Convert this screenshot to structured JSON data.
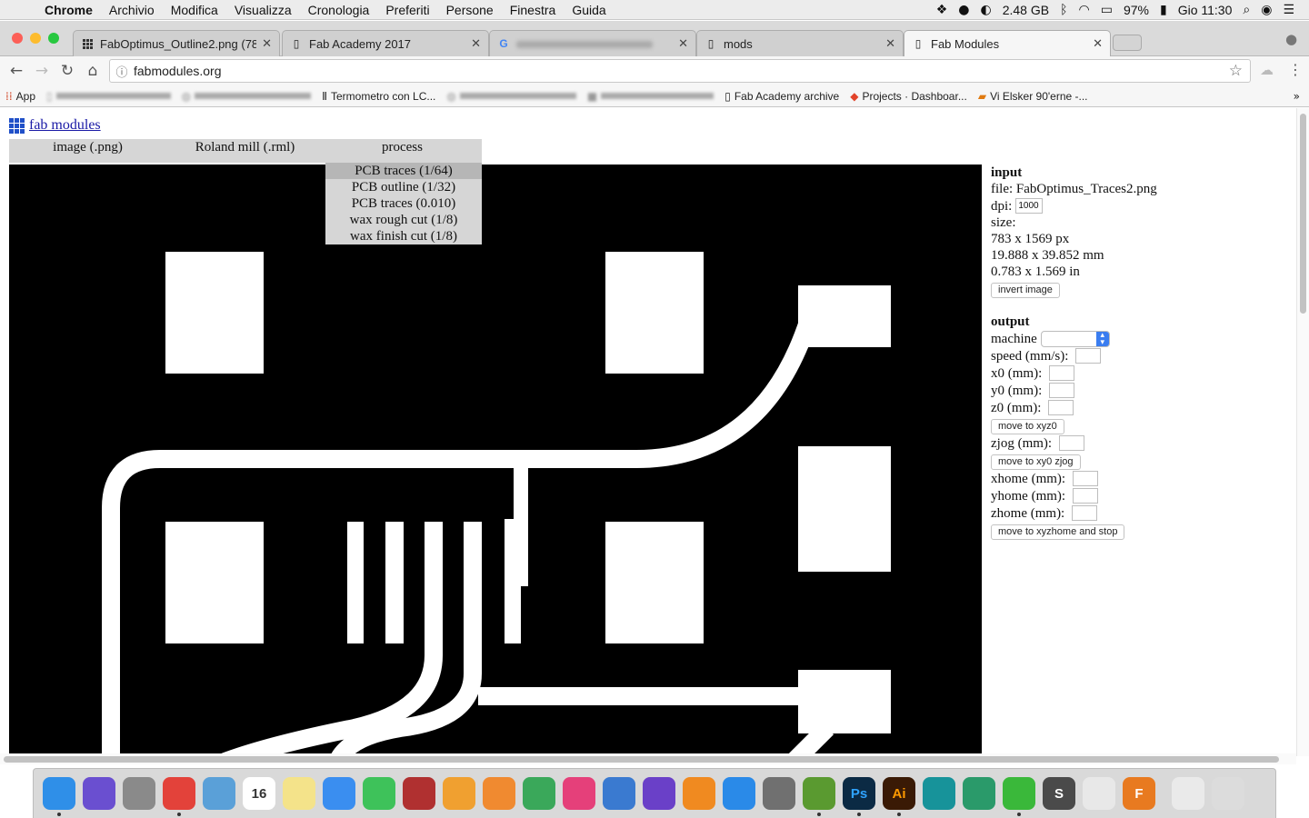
{
  "menubar": {
    "apple_icon": "apple-icon",
    "app_name": "Chrome",
    "items": [
      "Archivio",
      "Modifica",
      "Visualizza",
      "Cronologia",
      "Preferiti",
      "Persone",
      "Finestra",
      "Guida"
    ],
    "memory": "2.48 GB",
    "battery": "97%",
    "clock": "Gio 11:30"
  },
  "tabs": [
    {
      "title": "FabOptimus_Outline2.png (78",
      "icon": "grid-icon"
    },
    {
      "title": "Fab Academy 2017",
      "icon": "page-icon"
    },
    {
      "title": "",
      "icon": "google-icon"
    },
    {
      "title": "mods",
      "icon": "page-icon"
    },
    {
      "title": "Fab Modules",
      "icon": "page-icon"
    }
  ],
  "address": {
    "url": "fabmodules.org"
  },
  "bookmarks": [
    {
      "label": "App",
      "icon": "apps-grid-icon",
      "blurred": false
    },
    {
      "label": "",
      "icon": "page-icon",
      "blurred": true
    },
    {
      "label": "",
      "icon": "globe-icon",
      "blurred": true
    },
    {
      "label": "Termometro con LC...",
      "icon": "thermometer-icon",
      "blurred": false
    },
    {
      "label": "",
      "icon": "globe-icon",
      "blurred": true
    },
    {
      "label": "",
      "icon": "page-icon",
      "blurred": true
    },
    {
      "label": "Fab Academy archive",
      "icon": "page-icon",
      "blurred": false
    },
    {
      "label": "Projects · Dashboar...",
      "icon": "gitlab-icon",
      "blurred": false
    },
    {
      "label": "Vi Elsker 90'erne -...",
      "icon": "flag-icon",
      "blurred": false
    }
  ],
  "page": {
    "site_link": "fab modules",
    "menu": [
      "image (.png)",
      "Roland mill (.rml)",
      "process"
    ],
    "process_options": [
      "PCB traces (1/64)",
      "PCB outline (1/32)",
      "PCB traces (0.010)",
      "wax rough cut (1/8)",
      "wax finish cut (1/8)"
    ],
    "selected_process": "PCB traces (1/64)"
  },
  "panel": {
    "input_heading": "input",
    "file_line": "file: FabOptimus_Traces2.png",
    "dpi_label": "dpi:",
    "dpi_value": "1000",
    "size_label": "size:",
    "size_px": "783 x 1569 px",
    "size_mm": "19.888 x 39.852 mm",
    "size_in": "0.783 x 1.569 in",
    "invert_button": "invert image",
    "output_heading": "output",
    "machine_label": "machine",
    "speed_label": "speed (mm/s):",
    "x0_label": "x0 (mm):",
    "y0_label": "y0 (mm):",
    "z0_label": "z0 (mm):",
    "move_xyz0_button": "move to xyz0",
    "zjog_label": "zjog (mm):",
    "move_zjog_button": "move to xy0 zjog",
    "xhome_label": "xhome (mm):",
    "yhome_label": "yhome (mm):",
    "zhome_label": "zhome (mm):",
    "move_home_button": "move to xyzhome and stop"
  },
  "dock": [
    {
      "name": "finder-icon",
      "label": "",
      "color": "#2f8fe8"
    },
    {
      "name": "siri-icon",
      "label": "",
      "color": "#6a4fd0"
    },
    {
      "name": "launchpad-icon",
      "label": "",
      "color": "#8a8a8a"
    },
    {
      "name": "chrome-icon",
      "label": "",
      "color": "#e3423a"
    },
    {
      "name": "preview-icon",
      "label": "",
      "color": "#5aa0d8"
    },
    {
      "name": "calendar-icon",
      "label": "16",
      "color": "#ffffff"
    },
    {
      "name": "notes-icon",
      "label": "",
      "color": "#f4e38a"
    },
    {
      "name": "messages-icon",
      "label": "",
      "color": "#3a8ef0"
    },
    {
      "name": "facetime-icon",
      "label": "",
      "color": "#3ec25a"
    },
    {
      "name": "photobooth-icon",
      "label": "",
      "color": "#b03030"
    },
    {
      "name": "photos-icon",
      "label": "",
      "color": "#f0a030"
    },
    {
      "name": "pages-icon",
      "label": "",
      "color": "#f08a30"
    },
    {
      "name": "numbers-icon",
      "label": "",
      "color": "#3aa85a"
    },
    {
      "name": "itunes-icon",
      "label": "",
      "color": "#e5407a"
    },
    {
      "name": "keynote-icon",
      "label": "",
      "color": "#3a7ad0"
    },
    {
      "name": "imovie-icon",
      "label": "",
      "color": "#6a40c8"
    },
    {
      "name": "ibooks-icon",
      "label": "",
      "color": "#f08a20"
    },
    {
      "name": "appstore-icon",
      "label": "",
      "color": "#2a8ae8"
    },
    {
      "name": "system-preferences-icon",
      "label": "",
      "color": "#707070"
    },
    {
      "name": "qgis-icon",
      "label": "",
      "color": "#5a9a30"
    },
    {
      "name": "photoshop-icon",
      "label": "Ps",
      "color": "#0b2a44"
    },
    {
      "name": "illustrator-icon",
      "label": "Ai",
      "color": "#3a1a05"
    },
    {
      "name": "arduino-icon",
      "label": "",
      "color": "#17939a"
    },
    {
      "name": "atom-icon",
      "label": "",
      "color": "#2a9a6a"
    },
    {
      "name": "wechat-icon",
      "label": "",
      "color": "#3ab83a"
    },
    {
      "name": "sublime-icon",
      "label": "S",
      "color": "#4a4a4a"
    },
    {
      "name": "inkscape-icon",
      "label": "",
      "color": "#e8e8e8"
    },
    {
      "name": "fusion360-icon",
      "label": "F",
      "color": "#e87a20"
    },
    {
      "name": "desktop-icon",
      "label": "",
      "color": "#eaeaea"
    },
    {
      "name": "trash-icon",
      "label": "",
      "color": "#dcdcdc"
    }
  ]
}
